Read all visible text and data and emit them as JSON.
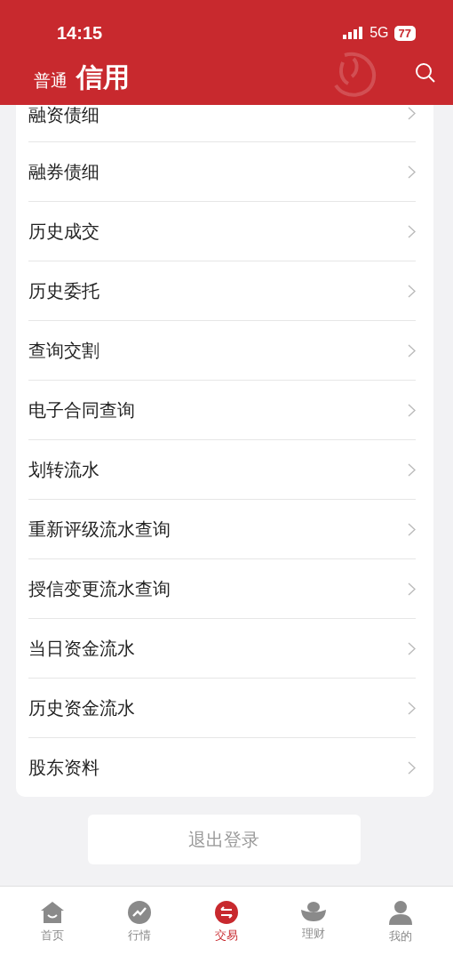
{
  "status_bar": {
    "time": "14:15",
    "network": "5G",
    "battery": "77"
  },
  "header_tabs": [
    {
      "label": "普通",
      "selected": false
    },
    {
      "label": "信用",
      "selected": true
    }
  ],
  "menu_items": [
    "融资债细",
    "融券债细",
    "历史成交",
    "历史委托",
    "查询交割",
    "电子合同查询",
    "划转流水",
    "重新评级流水查询",
    "授信变更流水查询",
    "当日资金流水",
    "历史资金流水",
    "股东资料"
  ],
  "logout_button": "退出登录",
  "tab_bar": [
    {
      "label": "首页",
      "selected": false
    },
    {
      "label": "行情",
      "selected": false
    },
    {
      "label": "交易",
      "selected": true
    },
    {
      "label": "理财",
      "selected": false
    },
    {
      "label": "我的",
      "selected": false
    }
  ]
}
